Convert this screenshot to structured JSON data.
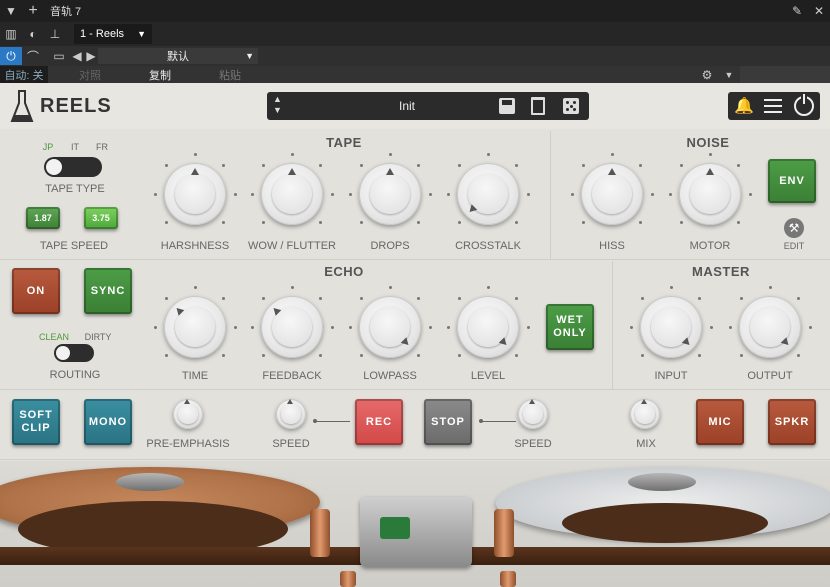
{
  "host": {
    "track_title": "音轨 7",
    "preset_slot": "1 - Reels",
    "preset_default": "默认",
    "auto_label": "自动: 关",
    "compare_label": "对照",
    "copy_label": "复制",
    "paste_label": "粘贴"
  },
  "plugin": {
    "name": "REELS",
    "preset_name": "Init",
    "sections": {
      "tape": "TAPE",
      "noise": "NOISE",
      "echo": "ECHO",
      "master": "MASTER"
    },
    "tape_type": {
      "label": "TAPE TYPE",
      "options": [
        "JP",
        "IT",
        "FR"
      ],
      "selected": "JP"
    },
    "tape_speed": {
      "label": "TAPE SPEED",
      "options": [
        "1.87",
        "3.75"
      ],
      "selected": "3.75"
    },
    "tape_knobs": [
      "HARSHNESS",
      "WOW / FLUTTER",
      "DROPS",
      "CROSSTALK"
    ],
    "noise_knobs": [
      "HISS",
      "MOTOR"
    ],
    "env_label": "ENV",
    "edit_label": "EDIT",
    "echo_on": "ON",
    "echo_sync": "SYNC",
    "routing": {
      "label": "ROUTING",
      "options": [
        "CLEAN",
        "DIRTY"
      ],
      "selected": "CLEAN"
    },
    "echo_knobs": [
      "TIME",
      "FEEDBACK",
      "LOWPASS",
      "LEVEL"
    ],
    "wet_only": "WET ONLY",
    "master_knobs": [
      "INPUT",
      "OUTPUT"
    ],
    "bottom": {
      "soft_clip": "SOFT CLIP",
      "mono": "MONO",
      "pre_emphasis": "PRE-EMPHASIS",
      "speed1": "SPEED",
      "rec": "REC",
      "stop": "STOP",
      "speed2": "SPEED",
      "mix": "MIX",
      "mic": "MIC",
      "spkr": "SPKR"
    },
    "colors": {
      "accent_green": "#3f8a3a",
      "accent_red": "#a84a2f",
      "accent_teal": "#2f7d8e",
      "rec_red": "#dc5555"
    }
  }
}
